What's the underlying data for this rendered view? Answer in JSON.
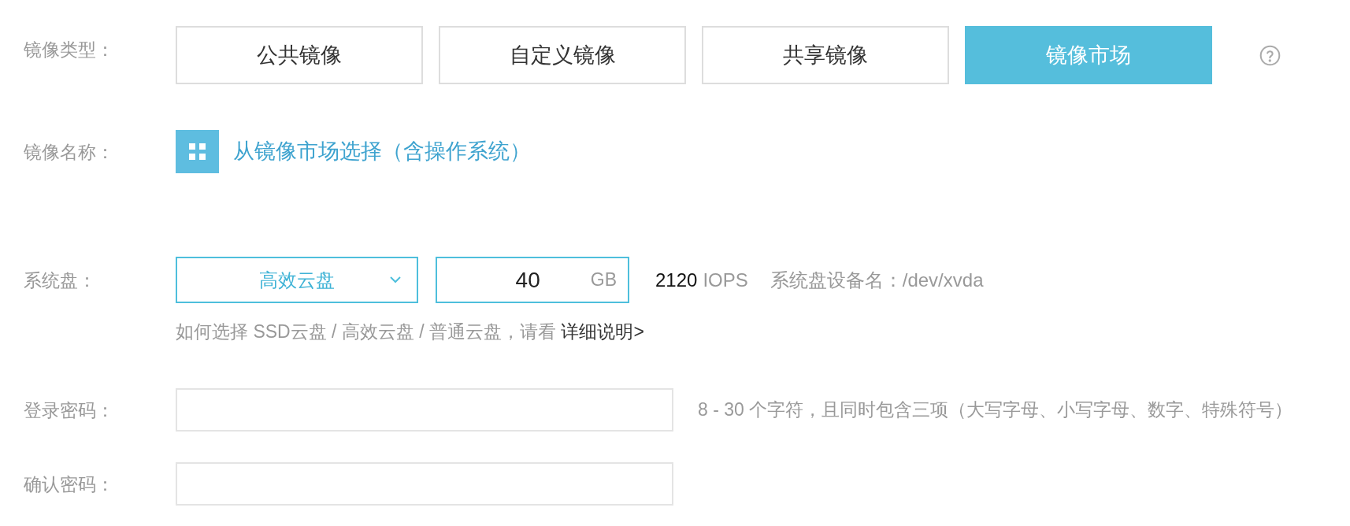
{
  "image_type": {
    "label": "镜像类型：",
    "tabs": [
      {
        "label": "公共镜像",
        "selected": false
      },
      {
        "label": "自定义镜像",
        "selected": false
      },
      {
        "label": "共享镜像",
        "selected": false
      },
      {
        "label": "镜像市场",
        "selected": true
      }
    ]
  },
  "image_name": {
    "label": "镜像名称：",
    "link": "从镜像市场选择（含操作系统）"
  },
  "system_disk": {
    "label": "系统盘：",
    "disk_type": "高效云盘",
    "size": {
      "value": "40",
      "unit": "GB"
    },
    "iops": {
      "value": "2120",
      "unit": "IOPS"
    },
    "device": "系统盘设备名：/dev/xvda",
    "help": {
      "text": "如何选择 SSD云盘 / 高效云盘 / 普通云盘，请看",
      "link": "详细说明>"
    }
  },
  "login_password": {
    "label": "登录密码：",
    "hint": "8 - 30 个字符，且同时包含三项（大写字母、小写字母、数字、特殊符号）"
  },
  "confirm_password": {
    "label": "确认密码："
  }
}
